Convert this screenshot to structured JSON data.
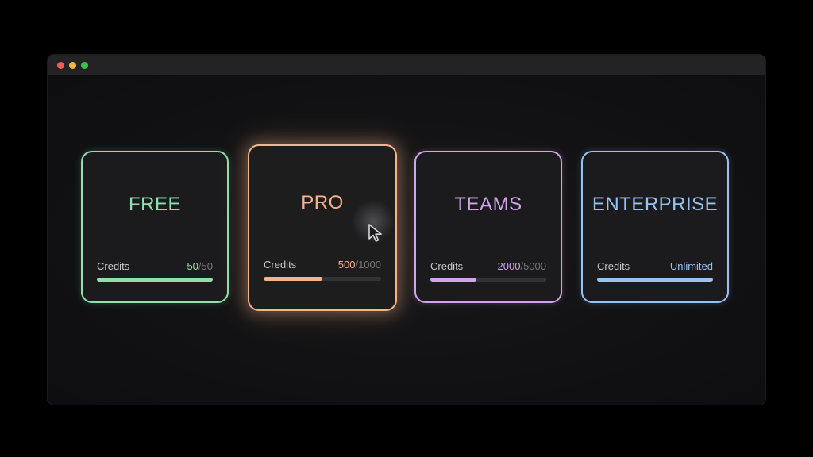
{
  "window": {
    "controls": [
      {
        "name": "close",
        "color": "#f25a54"
      },
      {
        "name": "minimize",
        "color": "#f5b93a"
      },
      {
        "name": "maximize",
        "color": "#38c24b"
      }
    ]
  },
  "plans": [
    {
      "name": "FREE",
      "credits_label": "Credits",
      "credits_used": "50",
      "credits_separator": "/",
      "credits_total": "50",
      "progress": 1.0,
      "accent": "#8fe0ac",
      "highlighted": false
    },
    {
      "name": "PRO",
      "credits_label": "Credits",
      "credits_used": "500",
      "credits_separator": "/",
      "credits_total": "1000",
      "progress": 0.5,
      "accent": "#f5b38a",
      "highlighted": true
    },
    {
      "name": "TEAMS",
      "credits_label": "Credits",
      "credits_used": "2000",
      "credits_separator": "/",
      "credits_total": "5000",
      "progress": 0.4,
      "accent": "#d0a5ec",
      "highlighted": false
    },
    {
      "name": "ENTERPRISE",
      "credits_label": "Credits",
      "credits_used": "Unlimited",
      "credits_separator": "",
      "credits_total": "",
      "progress": 1.0,
      "accent": "#98c2f2",
      "highlighted": false
    }
  ],
  "cursor": {
    "icon": "arrow-pointer-icon"
  }
}
